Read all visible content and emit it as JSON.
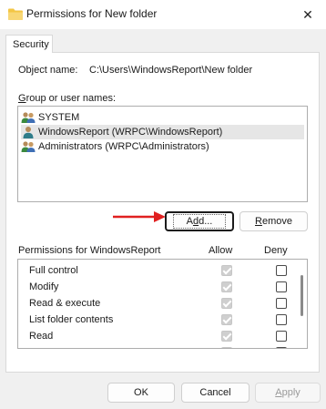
{
  "window": {
    "title": "Permissions for New folder",
    "close_glyph": "✕",
    "folder_icon": "folder-icon"
  },
  "tabs": [
    {
      "label": "Security",
      "active": true
    }
  ],
  "object": {
    "label": "Object name:",
    "value": "C:\\Users\\WindowsReport\\New folder"
  },
  "groups": {
    "label": "Group or user names:",
    "items": [
      {
        "name": "SYSTEM",
        "icon": "users-icon",
        "selected": false
      },
      {
        "name": "WindowsReport (WRPC\\WindowsReport)",
        "icon": "user-icon",
        "selected": true
      },
      {
        "name": "Administrators (WRPC\\Administrators)",
        "icon": "users-icon",
        "selected": false
      }
    ]
  },
  "buttons": {
    "add": "Add...",
    "remove": "Remove",
    "ok": "OK",
    "cancel": "Cancel",
    "apply": "Apply"
  },
  "permissions": {
    "label": "Permissions for WindowsReport",
    "allow_header": "Allow",
    "deny_header": "Deny",
    "rows": [
      {
        "name": "Full control",
        "allow": true,
        "deny": false
      },
      {
        "name": "Modify",
        "allow": true,
        "deny": false
      },
      {
        "name": "Read & execute",
        "allow": true,
        "deny": false
      },
      {
        "name": "List folder contents",
        "allow": true,
        "deny": false
      },
      {
        "name": "Read",
        "allow": true,
        "deny": false
      },
      {
        "name": "",
        "allow": true,
        "deny": false
      }
    ]
  },
  "colors": {
    "accent_arrow": "#e02020",
    "selection": "#e6e6e6",
    "panel": "#ffffff",
    "dialog": "#f0f0f0"
  }
}
